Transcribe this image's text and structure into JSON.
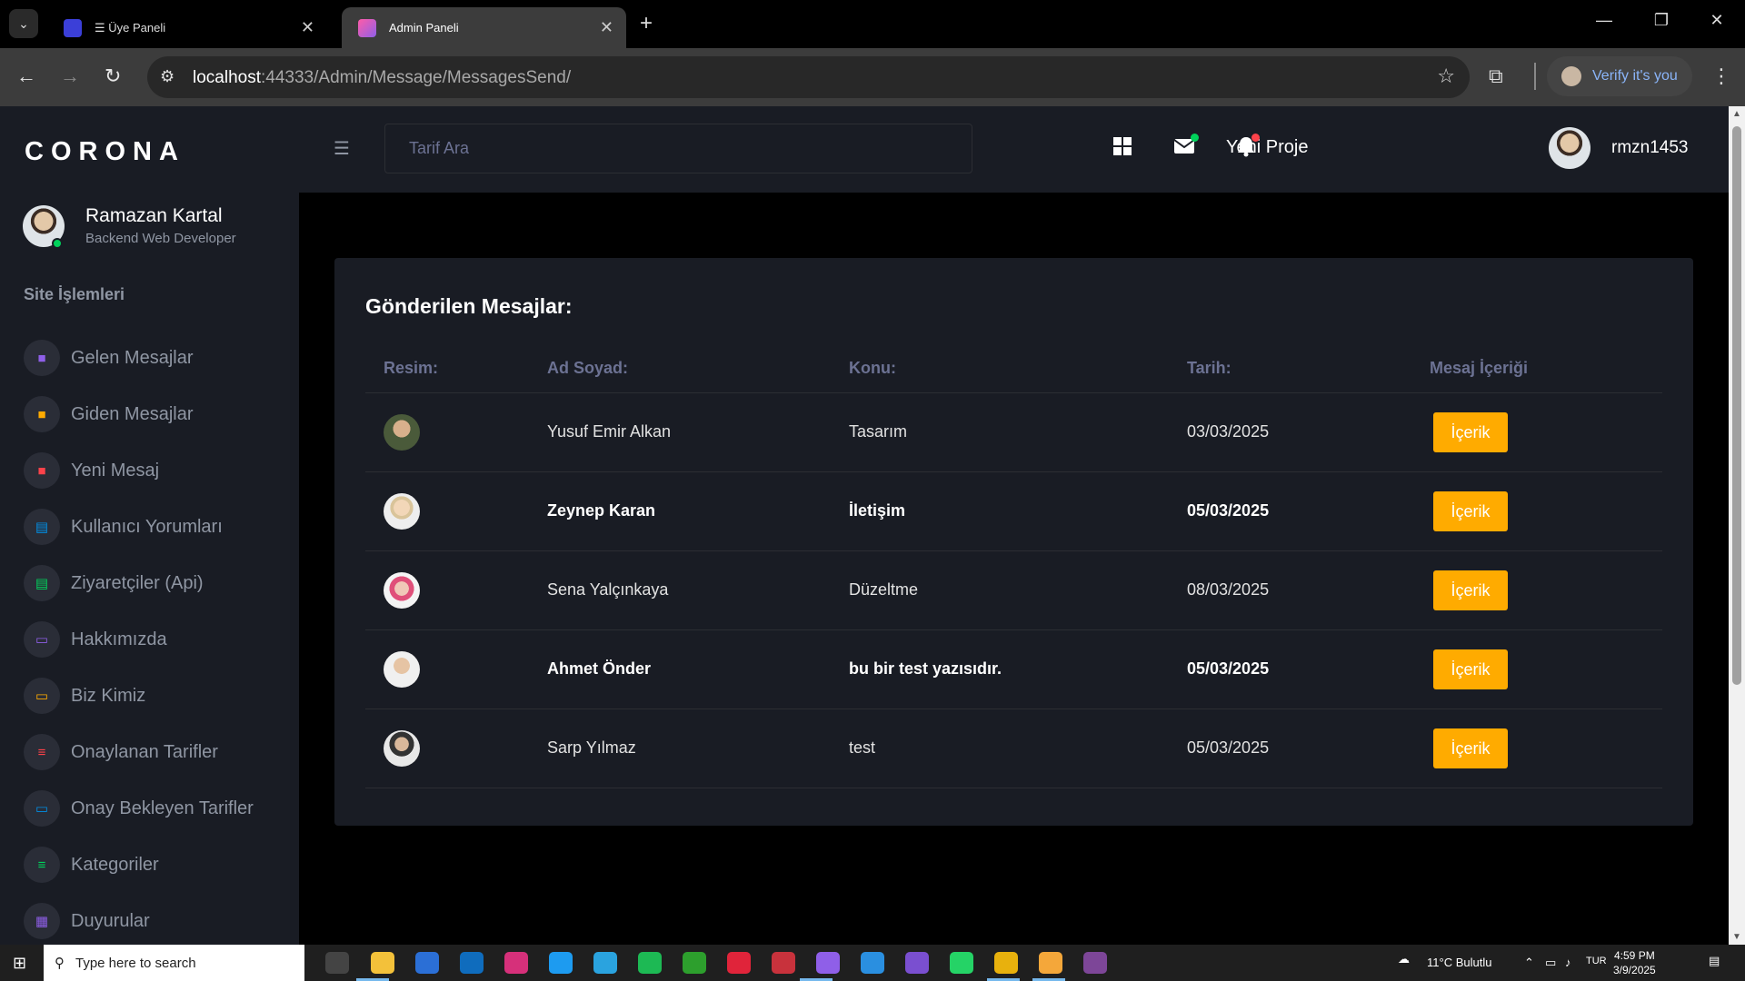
{
  "browser": {
    "tabs": [
      {
        "title": "☰ Üye Paneli",
        "active": false
      },
      {
        "title": "Admin Paneli",
        "active": true
      }
    ],
    "url_host": "localhost",
    "url_rest": ":44333/Admin/Message/MessagesSend/",
    "verify_label": "Verify it's you"
  },
  "sidebar": {
    "brand": "CORONA",
    "profile_name": "Ramazan Kartal",
    "profile_role": "Backend Web Developer",
    "section_title": "Site İşlemleri",
    "items": [
      {
        "label": "Gelen Mesajlar",
        "icon": "chat-icon",
        "color": "#8f5fe8"
      },
      {
        "label": "Giden Mesajlar",
        "icon": "chat-icon",
        "color": "#ffab00"
      },
      {
        "label": "Yeni Mesaj",
        "icon": "chat-icon",
        "color": "#fc424a"
      },
      {
        "label": "Kullanıcı Yorumları",
        "icon": "document-icon",
        "color": "#0090e7"
      },
      {
        "label": "Ziyaretçiler (Api)",
        "icon": "document-icon",
        "color": "#00d25b"
      },
      {
        "label": "Hakkımızda",
        "icon": "laptop-icon",
        "color": "#8f5fe8"
      },
      {
        "label": "Biz Kimiz",
        "icon": "laptop-icon",
        "color": "#ffab00"
      },
      {
        "label": "Onaylanan Tarifler",
        "icon": "playlist-icon",
        "color": "#fc424a"
      },
      {
        "label": "Onay Bekleyen Tarifler",
        "icon": "laptop-icon",
        "color": "#0090e7"
      },
      {
        "label": "Kategoriler",
        "icon": "playlist-icon",
        "color": "#00d25b"
      },
      {
        "label": "Duyurular",
        "icon": "table-icon",
        "color": "#8f5fe8"
      }
    ]
  },
  "topnav": {
    "search_placeholder": "Tarif Ara",
    "new_project": "Yeni Proje",
    "username": "rmzn1453"
  },
  "card": {
    "title": "Gönderilen Mesajlar:",
    "columns": [
      "Resim:",
      "Ad Soyad:",
      "Konu:",
      "Tarih:",
      "Mesaj İçeriği"
    ],
    "button_label": "İçerik",
    "rows": [
      {
        "name": "Yusuf Emir Alkan",
        "subject": "Tasarım",
        "date": "03/03/2025",
        "highlight": false
      },
      {
        "name": "Zeynep Karan",
        "subject": "İletişim",
        "date": "05/03/2025",
        "highlight": true
      },
      {
        "name": "Sena Yalçınkaya",
        "subject": "Düzeltme",
        "date": "08/03/2025",
        "highlight": false
      },
      {
        "name": "Ahmet Önder",
        "subject": "bu bir test yazısıdır.",
        "date": "05/03/2025",
        "highlight": true
      },
      {
        "name": "Sarp Yılmaz",
        "subject": "test",
        "date": "05/03/2025",
        "highlight": false
      }
    ]
  },
  "taskbar": {
    "search_placeholder": "Type here to search",
    "weather": "11°C  Bulutlu",
    "lang": "TUR",
    "time": "4:59 PM",
    "date": "3/9/2025"
  },
  "colors": {
    "accent_orange": "#ffab00",
    "panel_bg": "#191c24",
    "muted_text": "#8f96a3"
  }
}
